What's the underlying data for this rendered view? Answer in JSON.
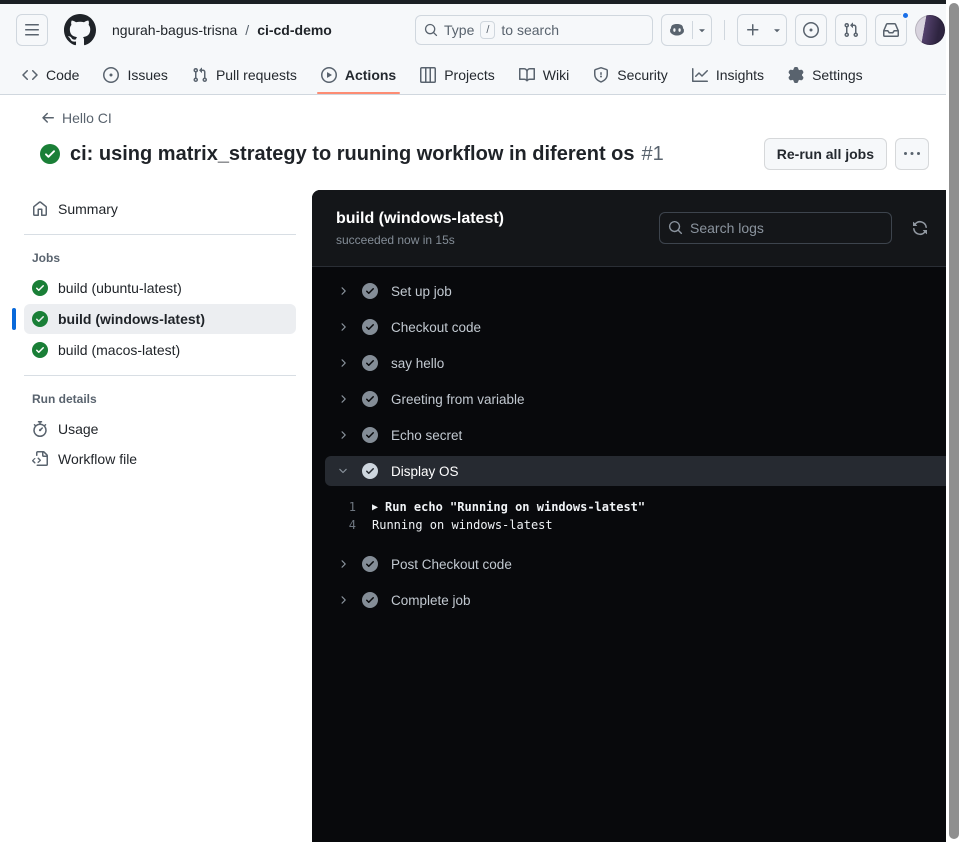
{
  "colors": {
    "header_bg": "#f6f8fa",
    "accent_underline": "#fd8c73",
    "success_green": "#1a7f37",
    "selected_blue": "#0969da",
    "notification_blue": "#1a6fe8",
    "log_panel_bg": "#08090c",
    "log_header_bg": "#141619"
  },
  "header": {
    "owner": "ngurah-bagus-trisna",
    "breadcrumb_separator": "/",
    "repo": "ci-cd-demo",
    "search_prefix": "Type",
    "search_key": "/",
    "search_suffix": "to search"
  },
  "nav": {
    "code": "Code",
    "issues": "Issues",
    "pull_requests": "Pull requests",
    "actions": "Actions",
    "projects": "Projects",
    "wiki": "Wiki",
    "security": "Security",
    "insights": "Insights",
    "settings": "Settings"
  },
  "run": {
    "back_link": "Hello CI",
    "title": "ci: using matrix_strategy to ruuning workflow in diferent os",
    "number": "#1",
    "rerun_button": "Re-run all jobs"
  },
  "sidebar": {
    "summary": "Summary",
    "jobs_heading": "Jobs",
    "jobs": [
      {
        "label": "build (ubuntu-latest)"
      },
      {
        "label": "build (windows-latest)"
      },
      {
        "label": "build (macos-latest)"
      }
    ],
    "run_details_heading": "Run details",
    "usage": "Usage",
    "workflow_file": "Workflow file"
  },
  "log": {
    "job_title": "build (windows-latest)",
    "job_status": "succeeded now in 15s",
    "search_placeholder": "Search logs",
    "steps": [
      {
        "label": "Set up job"
      },
      {
        "label": "Checkout code"
      },
      {
        "label": "say hello"
      },
      {
        "label": "Greeting from variable"
      },
      {
        "label": "Echo secret"
      },
      {
        "label": "Display OS"
      },
      {
        "label": "Post Checkout code"
      },
      {
        "label": "Complete job"
      }
    ],
    "lines": [
      {
        "num": "1",
        "marker": "▶",
        "text": "Run echo \"Running on windows-latest\""
      },
      {
        "num": "4",
        "marker": "",
        "text": "Running on windows-latest"
      }
    ]
  }
}
